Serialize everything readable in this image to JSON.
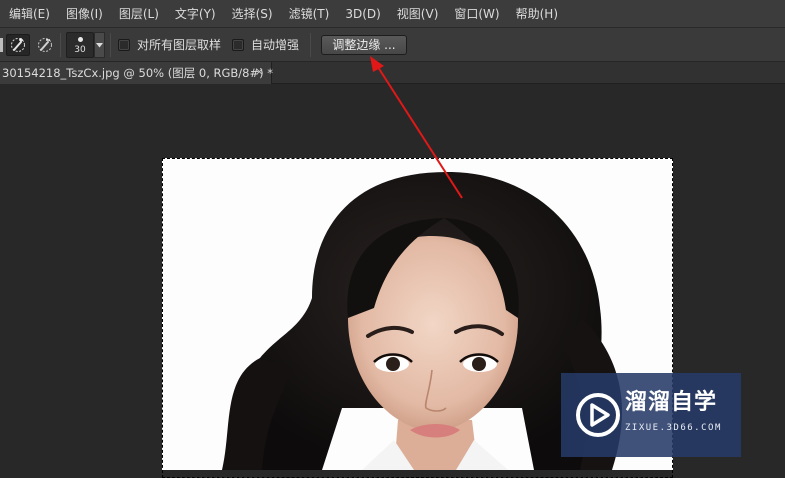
{
  "menu": {
    "items": [
      {
        "label": "编辑(E)"
      },
      {
        "label": "图像(I)"
      },
      {
        "label": "图层(L)"
      },
      {
        "label": "文字(Y)"
      },
      {
        "label": "选择(S)"
      },
      {
        "label": "滤镜(T)"
      },
      {
        "label": "3D(D)"
      },
      {
        "label": "视图(V)"
      },
      {
        "label": "窗口(W)"
      },
      {
        "label": "帮助(H)"
      }
    ]
  },
  "options": {
    "tools": [
      {
        "icon": "quick-selection-add-icon",
        "active": true
      },
      {
        "icon": "quick-selection-subtract-icon",
        "active": false
      }
    ],
    "brush_size": "30",
    "sample_all_layers_label": "对所有图层取样",
    "sample_all_layers_checked": false,
    "auto_enhance_label": "自动增强",
    "auto_enhance_checked": false,
    "refine_edge_label": "调整边缘 ..."
  },
  "document": {
    "tab_title": "30154218_TszCx.jpg @ 50% (图层 0, RGB/8#) *",
    "close_symbol": "×"
  },
  "annotation": {
    "arrow_color": "#e01818"
  },
  "watermark": {
    "title": "溜溜自学",
    "subtitle": "ZIXUE.3D66.COM",
    "color": "#263a66"
  },
  "colors": {
    "menubar_bg": "#3c3c3c",
    "workspace_bg": "#282828"
  }
}
